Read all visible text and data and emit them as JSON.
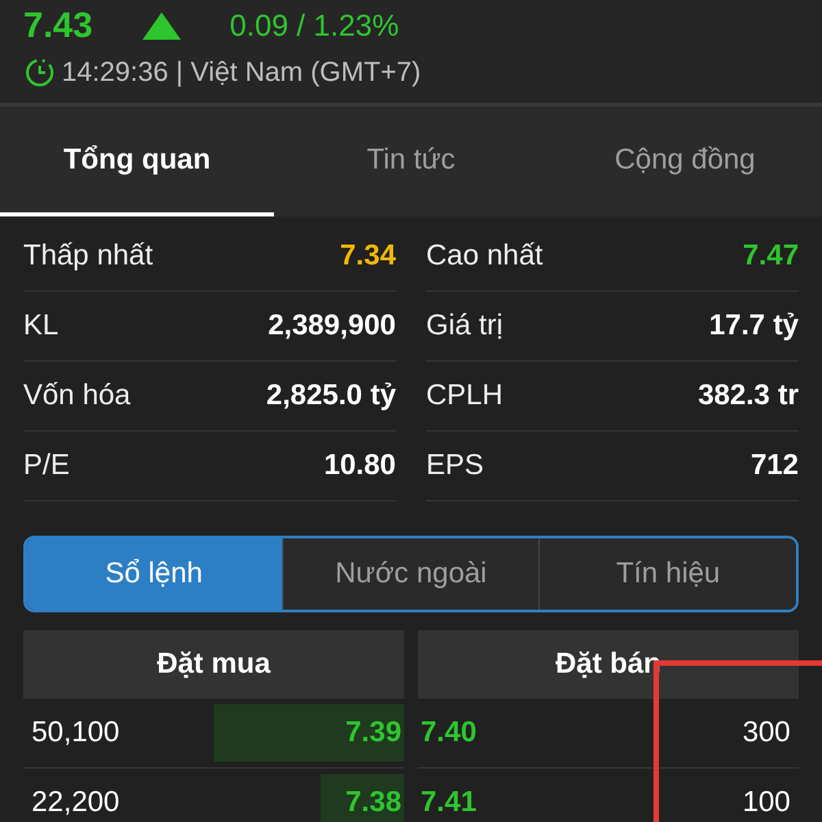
{
  "quote": {
    "price": "7.43",
    "rising": true,
    "change": "0.09 / 1.23%",
    "time": "14:29:36 | Việt Nam (GMT+7)"
  },
  "tabs": [
    {
      "label": "Tổng quan",
      "selected": true
    },
    {
      "label": "Tin tức",
      "selected": false
    },
    {
      "label": "Cộng đồng",
      "selected": false
    }
  ],
  "stats": [
    [
      {
        "label": "Thấp nhất",
        "value": "7.34",
        "color": "#f2b705"
      },
      {
        "label": "Cao nhất",
        "value": "7.47",
        "color": "#2ec52e"
      }
    ],
    [
      {
        "label": "KL",
        "value": "2,389,900",
        "color": "#ffffff"
      },
      {
        "label": "Giá trị",
        "value": "17.7 tỷ",
        "color": "#ffffff"
      }
    ],
    [
      {
        "label": "Vốn hóa",
        "value": "2,825.0 tỷ",
        "color": "#ffffff"
      },
      {
        "label": "CPLH",
        "value": "382.3 tr",
        "color": "#ffffff"
      }
    ],
    [
      {
        "label": "P/E",
        "value": "10.80",
        "color": "#ffffff"
      },
      {
        "label": "EPS",
        "value": "712",
        "color": "#ffffff"
      }
    ]
  ],
  "segments": [
    {
      "label": "Sổ lệnh",
      "selected": true
    },
    {
      "label": "Nước ngoài",
      "selected": false
    },
    {
      "label": "Tín hiệu",
      "selected": false
    }
  ],
  "order_book": {
    "buy_header": "Đặt mua",
    "sell_header": "Đặt bán",
    "rows": [
      {
        "buy_volume": "50,100",
        "buy_price": "7.39",
        "level": 0.5,
        "sell_price": "7.40",
        "sell_volume": "300"
      },
      {
        "buy_volume": "22,200",
        "buy_price": "7.38",
        "level": 0.22,
        "sell_price": "7.41",
        "sell_volume": "100"
      }
    ]
  },
  "annotation": {
    "kind": "rectangle"
  }
}
